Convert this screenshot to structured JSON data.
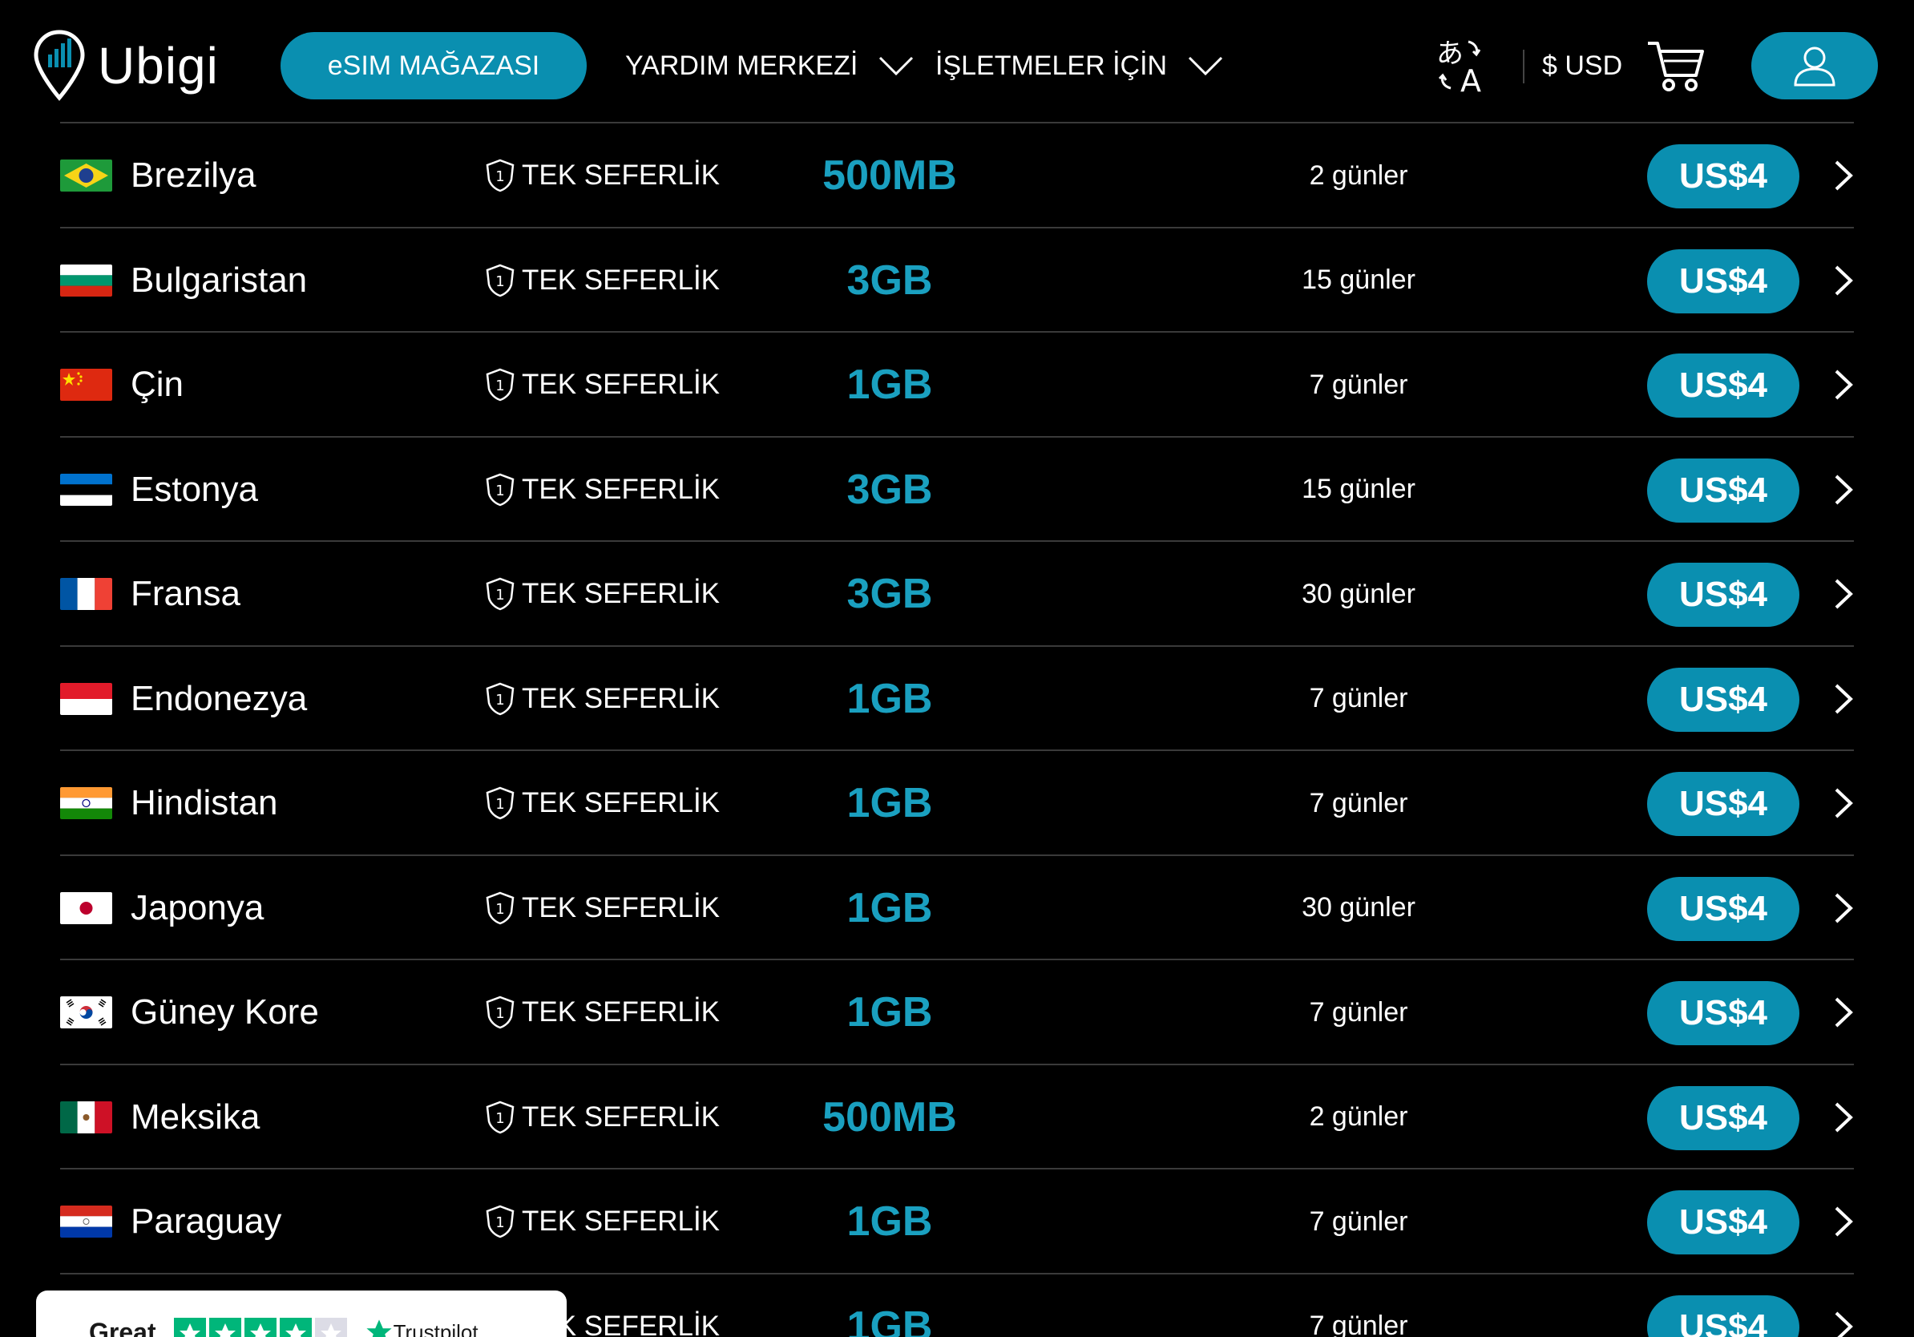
{
  "header": {
    "logo_text": "Ubigi",
    "store_label": "eSIM MAĞAZASI",
    "help_label": "YARDIM MERKEZİ",
    "business_label": "İŞLETMELER İÇİN",
    "currency_label": "$ USD",
    "accent_color": "#0a8fb0"
  },
  "plans": [
    {
      "country": "Brezilya",
      "plan_type": "TEK SEFERLİK",
      "data": "500MB",
      "duration": "2 günler",
      "price": "US$4",
      "flag": "brazil"
    },
    {
      "country": "Bulgaristan",
      "plan_type": "TEK SEFERLİK",
      "data": "3GB",
      "duration": "15 günler",
      "price": "US$4",
      "flag": "bulgaria"
    },
    {
      "country": "Çin",
      "plan_type": "TEK SEFERLİK",
      "data": "1GB",
      "duration": "7 günler",
      "price": "US$4",
      "flag": "china"
    },
    {
      "country": "Estonya",
      "plan_type": "TEK SEFERLİK",
      "data": "3GB",
      "duration": "15 günler",
      "price": "US$4",
      "flag": "estonia"
    },
    {
      "country": "Fransa",
      "plan_type": "TEK SEFERLİK",
      "data": "3GB",
      "duration": "30 günler",
      "price": "US$4",
      "flag": "france"
    },
    {
      "country": "Endonezya",
      "plan_type": "TEK SEFERLİK",
      "data": "1GB",
      "duration": "7 günler",
      "price": "US$4",
      "flag": "indonesia"
    },
    {
      "country": "Hindistan",
      "plan_type": "TEK SEFERLİK",
      "data": "1GB",
      "duration": "7 günler",
      "price": "US$4",
      "flag": "india"
    },
    {
      "country": "Japonya",
      "plan_type": "TEK SEFERLİK",
      "data": "1GB",
      "duration": "30 günler",
      "price": "US$4",
      "flag": "japan"
    },
    {
      "country": "Güney Kore",
      "plan_type": "TEK SEFERLİK",
      "data": "1GB",
      "duration": "7 günler",
      "price": "US$4",
      "flag": "south-korea"
    },
    {
      "country": "Meksika",
      "plan_type": "TEK SEFERLİK",
      "data": "500MB",
      "duration": "2 günler",
      "price": "US$4",
      "flag": "mexico"
    },
    {
      "country": "Paraguay",
      "plan_type": "TEK SEFERLİK",
      "data": "1GB",
      "duration": "7 günler",
      "price": "US$4",
      "flag": "paraguay"
    },
    {
      "country": "",
      "plan_type": "TEK SEFERLİK",
      "data": "1GB",
      "duration": "7 günler",
      "price": "US$4",
      "flag": ""
    }
  ],
  "trustpilot": {
    "rating_label": "Great",
    "brand": "Trustpilot",
    "stars_filled": 4,
    "stars_total": 5,
    "star_color": "#00b67a"
  }
}
